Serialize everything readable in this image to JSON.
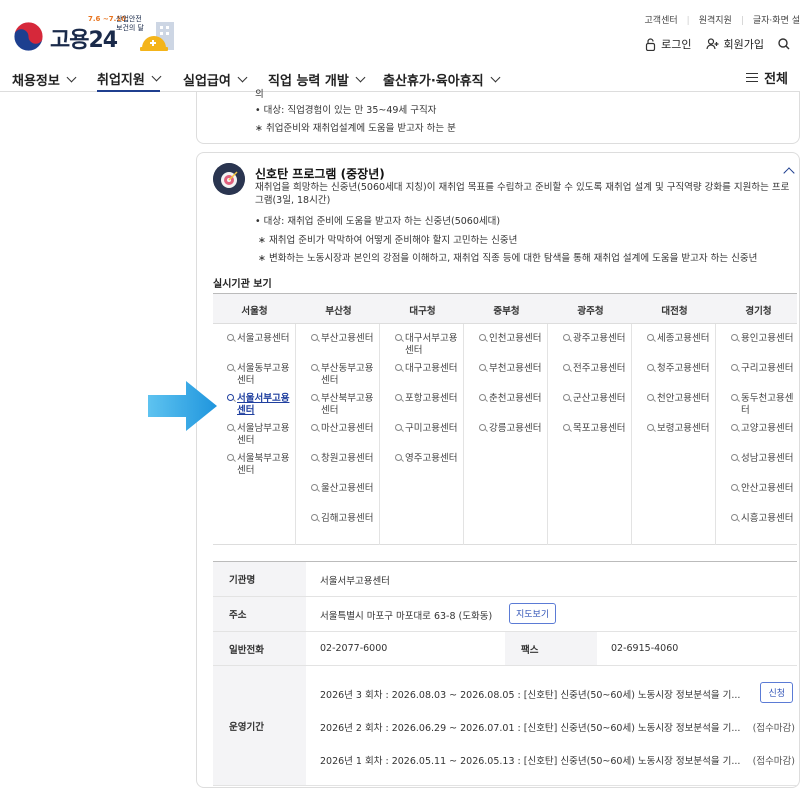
{
  "header": {
    "logo_text": "고용24",
    "event_date": "7.6 ~7.10",
    "event_text": "산업안전 보건의 달",
    "util_links": [
      "고객센터",
      "원격지원",
      "글자·화면 설"
    ],
    "login": "로그인",
    "signup": "회원가입"
  },
  "nav": {
    "items": [
      "채용정보",
      "취업지원",
      "실업급여",
      "직업 능력 개발",
      "출산휴가·육아휴직"
    ],
    "all_menu": "전체"
  },
  "prev_card": {
    "line0": "의",
    "line1": "• 대상: 직업경험이 있는 만 35~49세 구직자",
    "line2": "∗ 취업준비와 재취업설계에 도움을 받고자 하는 분"
  },
  "program": {
    "title": "신호탄 프로그램 (중장년)",
    "desc": "재취업을 희망하는 신중년(5060세대 지칭)이 재취업 목표를 수립하고 준비할 수 있도록 재취업 설계 및 구직역량 강화를 지원하는 프로그램(3일, 18시간)",
    "target": "• 대상: 재취업 준비에 도움을 받고자 하는 신중년(5060세대)",
    "note1": "∗ 재취업 준비가 막막하여 어떻게 준비해야 할지 고민하는 신중년",
    "note2": "∗ 변화하는 노동시장과 본인의 강점을 이해하고, 재취업 직종 등에 대한 탐색을 통해 재취업 설계에 도움을 받고자 하는 신중년",
    "section_title": "실시기관 보기"
  },
  "regions": [
    {
      "name": "서울청",
      "offices": [
        "서울고용센터",
        "서울동부고용센터",
        "서울서부고용센터",
        "서울남부고용센터",
        "서울북부고용센터"
      ]
    },
    {
      "name": "부산청",
      "offices": [
        "부산고용센터",
        "부산동부고용센터",
        "부산북부고용센터",
        "마산고용센터",
        "창원고용센터",
        "울산고용센터",
        "김해고용센터"
      ]
    },
    {
      "name": "대구청",
      "offices": [
        "대구서부고용센터",
        "대구고용센터",
        "포항고용센터",
        "구미고용센터",
        "영주고용센터"
      ]
    },
    {
      "name": "중부청",
      "offices": [
        "인천고용센터",
        "부천고용센터",
        "춘천고용센터",
        "강릉고용센터"
      ]
    },
    {
      "name": "광주청",
      "offices": [
        "광주고용센터",
        "전주고용센터",
        "군산고용센터",
        "목포고용센터"
      ]
    },
    {
      "name": "대전청",
      "offices": [
        "세종고용센터",
        "청주고용센터",
        "천안고용센터",
        "보령고용센터"
      ]
    },
    {
      "name": "경기청",
      "offices": [
        "용인고용센터",
        "구리고용센터",
        "동두천고용센터",
        "고양고용센터",
        "성남고용센터",
        "안산고용센터",
        "시흥고용센터"
      ]
    }
  ],
  "selected_office": "서울서부고용센터",
  "detail": {
    "name_label": "기관명",
    "name_value": "서울서부고용센터",
    "address_label": "주소",
    "address_value": "서울특별시 마포구 마포대로 63-8 (도화동)",
    "map_button": "지도보기",
    "phone_label": "일반전화",
    "phone_value": "02-2077-6000",
    "fax_label": "팩스",
    "fax_value": "02-6915-4060",
    "period_label": "운영기간",
    "schedule": [
      {
        "text": "2026년   3 회차 : 2026.08.03 ~ 2026.08.05 : [신호탄] 신중년(50~60세) 노동시장 정보분석을 기...",
        "status": "신청"
      },
      {
        "text": "2026년   2 회차 : 2026.06.29 ~ 2026.07.01 : [신호탄] 신중년(50~60세) 노동시장 정보분석을 기...",
        "status": "(접수마감)"
      },
      {
        "text": "2026년   1 회차 : 2026.05.11 ~ 2026.05.13 : [신호탄] 신중년(50~60세) 노동시장 정보분석을 기...",
        "status": "(접수마감)"
      }
    ]
  },
  "colors": {
    "brand_navy": "#1f3f8f",
    "arrow_blue": "#2fa8e6",
    "link_blue": "#1f3f9f"
  }
}
